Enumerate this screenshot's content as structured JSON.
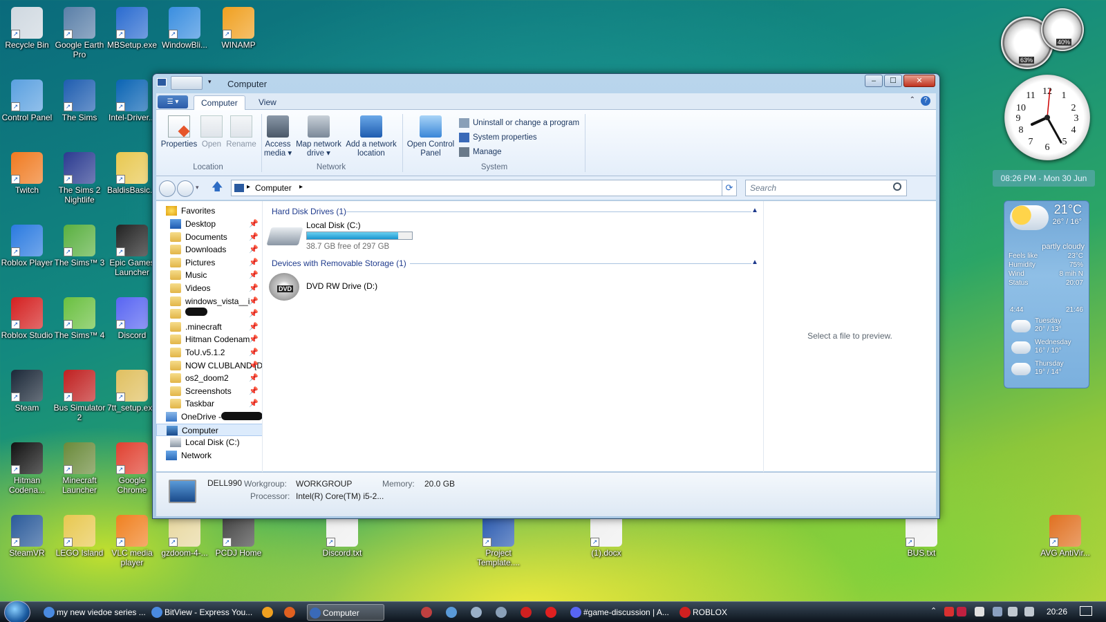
{
  "desktop_icons": [
    {
      "label": "Recycle Bin",
      "color": "#cfd8e0"
    },
    {
      "label": "Google Earth Pro",
      "color": "#5a7fa8"
    },
    {
      "label": "MBSetup.exe",
      "color": "#2a6bd0"
    },
    {
      "label": "WindowBli...",
      "color": "#3a8ee0"
    },
    {
      "label": "WINAMP",
      "color": "#f0a020"
    },
    {
      "label": "Control Panel",
      "color": "#5aa0e0"
    },
    {
      "label": "The Sims",
      "color": "#1e5db0"
    },
    {
      "label": "Intel-Driver...",
      "color": "#0a64b4"
    },
    {
      "label": "Twitch",
      "color": "#f07a20"
    },
    {
      "label": "The Sims 2 Nightlife",
      "color": "#2a3a90"
    },
    {
      "label": "BaldisBasic...",
      "color": "#e8c850"
    },
    {
      "label": "Roblox Player",
      "color": "#2a7ae0"
    },
    {
      "label": "The Sims™ 3",
      "color": "#5ab040"
    },
    {
      "label": "Epic Games Launcher",
      "color": "#222222"
    },
    {
      "label": "Roblox Studio",
      "color": "#d42020"
    },
    {
      "label": "The Sims™ 4",
      "color": "#6ac040"
    },
    {
      "label": "Discord",
      "color": "#5865f2"
    },
    {
      "label": "Steam",
      "color": "#1b2838"
    },
    {
      "label": "Bus Simulator 2",
      "color": "#c02020"
    },
    {
      "label": "7tt_setup.exe",
      "color": "#e0c060"
    },
    {
      "label": "Hitman Codena...",
      "color": "#111111"
    },
    {
      "label": "Minecraft Launcher",
      "color": "#6a8a3a"
    },
    {
      "label": "Google Chrome",
      "color": "#e04030"
    },
    {
      "label": "SteamVR",
      "color": "#2a5a9a"
    },
    {
      "label": "LEGO Island",
      "color": "#e8c850"
    },
    {
      "label": "VLC media player",
      "color": "#f08020"
    },
    {
      "label": "gzdoom-4-...",
      "color": "#e8d8a0"
    },
    {
      "label": "PCDJ Home",
      "color": "#444444"
    },
    {
      "label": "Discord.txt",
      "color": "#f0f0f0"
    },
    {
      "label": "Project Template....",
      "color": "#2a5ab0"
    },
    {
      "label": "(1).docx",
      "color": "#f0f0f0"
    },
    {
      "label": "BUS.txt",
      "color": "#f0f0f0"
    },
    {
      "label": "AVG AntiVir...",
      "color": "#e07020"
    }
  ],
  "window": {
    "title": "Computer",
    "tabs": [
      "Computer",
      "View"
    ],
    "ribbon": {
      "properties": "Properties",
      "open": "Open",
      "rename": "Rename",
      "access_media": "Access media ▾",
      "map_network_drive": "Map network drive ▾",
      "add_network_location": "Add a network location",
      "open_control_panel": "Open Control Panel",
      "uninstall": "Uninstall or change a program",
      "system_properties": "System properties",
      "manage": "Manage",
      "group_location": "Location",
      "group_network": "Network",
      "group_system": "System"
    },
    "address": {
      "crumb": "Computer",
      "search_placeholder": "Search"
    },
    "nav": {
      "favorites": "Favorites",
      "items": [
        "Desktop",
        "Documents",
        "Downloads",
        "Pictures",
        "Music",
        "Videos",
        "windows_vista__i",
        "",
        ".minecraft",
        "Hitman Codenam",
        "ToU.v5.1.2",
        "NOW CLUBLAND [Di",
        "os2_doom2",
        "Screenshots",
        "Taskbar"
      ],
      "onedrive": "OneDrive -",
      "computer": "Computer",
      "local_disk": "Local Disk (C:)",
      "network": "Network"
    },
    "groups": {
      "hdd_header": "Hard Disk Drives (1)",
      "removable_header": "Devices with Removable Storage (1)"
    },
    "drive_c": {
      "name": "Local Disk (C:)",
      "free_text": "38.7 GB free of 297 GB",
      "used_fraction": 0.87
    },
    "drive_d": {
      "name": "DVD RW Drive (D:)",
      "icon_text": "DVD"
    },
    "preview_text": "Select a file to preview.",
    "details": {
      "pc_name": "DELL990",
      "workgroup_label": "Workgroup:",
      "workgroup": "WORKGROUP",
      "memory_label": "Memory:",
      "memory": "20.0 GB",
      "processor_label": "Processor:",
      "processor": "Intel(R) Core(TM) i5-2..."
    }
  },
  "gadgets": {
    "cpu_percent": "63%",
    "ram_percent": "40%",
    "date_banner": "08:26 PM - Mon 30 Jun",
    "weather": {
      "temp": "21°C",
      "range": "26° / 16°",
      "condition": "partly cloudy",
      "rows": [
        [
          "Feels like",
          "23°C"
        ],
        [
          "Humidity",
          "75%"
        ],
        [
          "Wind",
          "8 mih N"
        ],
        [
          "Status",
          "20:07"
        ]
      ],
      "sunrise": "4:44",
      "sunset": "21:46",
      "forecast": [
        [
          "Tuesday",
          "20° / 13°"
        ],
        [
          "Wednesday",
          "16° / 10°"
        ],
        [
          "Thursday",
          "19° / 14°"
        ]
      ]
    }
  },
  "taskbar": {
    "buttons": [
      "my new viedoe series ...",
      "BitView - Express You...",
      "",
      "",
      "Computer",
      "",
      "",
      "",
      "",
      "",
      "",
      "#game-discussion | A...",
      "ROBLOX"
    ],
    "time": "20:26"
  }
}
